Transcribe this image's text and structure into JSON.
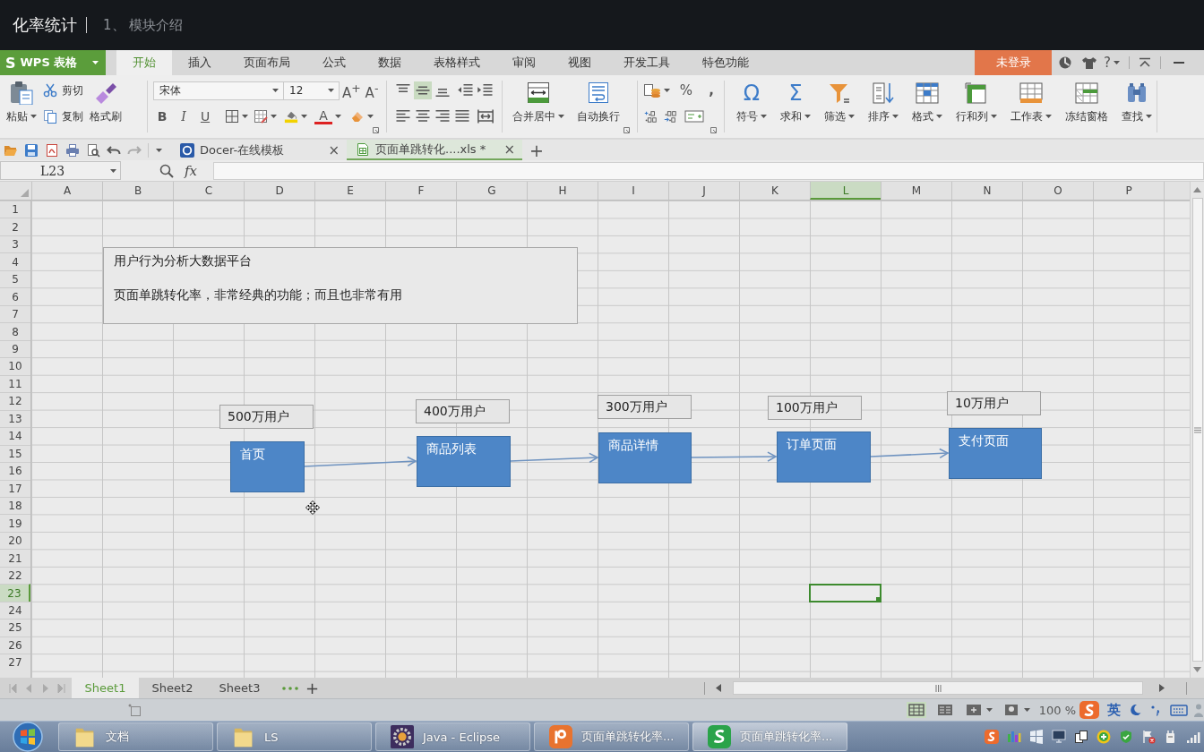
{
  "video_header": {
    "title": "化率统计",
    "subtitle": "1、 模块介绍"
  },
  "menu_bar": {
    "app_logo": "S",
    "app_name": "WPS 表格",
    "tabs": [
      {
        "label": "开始",
        "selected": true
      },
      {
        "label": "插入",
        "selected": false
      },
      {
        "label": "页面布局",
        "selected": false
      },
      {
        "label": "公式",
        "selected": false
      },
      {
        "label": "数据",
        "selected": false
      },
      {
        "label": "表格样式",
        "selected": false
      },
      {
        "label": "审阅",
        "selected": false
      },
      {
        "label": "视图",
        "selected": false
      },
      {
        "label": "开发工具",
        "selected": false
      },
      {
        "label": "特色功能",
        "selected": false
      }
    ],
    "login_button": "未登录",
    "help": "?"
  },
  "ribbon": {
    "paste": "粘贴",
    "cut": "剪切",
    "copy": "复制",
    "format_painter": "格式刷",
    "font_name": "宋体",
    "font_size": "12",
    "grow_font": "A$^{+}$",
    "shrink_font": "A$^{-}$",
    "bold": "B",
    "italic": "I",
    "underline": "U",
    "font_color": "A",
    "vertical_align": [
      {
        "selected": false
      },
      {
        "selected": true
      },
      {
        "selected": false
      }
    ],
    "merge_center": "合并居中",
    "wrap_text": "自动换行",
    "percent": "%",
    "thousands": ",",
    "tools": [
      {
        "label": "符号",
        "glyph": "Ω",
        "dropdown": true
      },
      {
        "label": "求和",
        "glyph": "Σ",
        "dropdown": true
      },
      {
        "label": "筛选",
        "dropdown": true
      },
      {
        "label": "排序",
        "dropdown": true
      },
      {
        "label": "格式",
        "dropdown": true
      },
      {
        "label": "行和列",
        "dropdown": true
      },
      {
        "label": "工作表",
        "dropdown": true
      },
      {
        "label": "冻结窗格",
        "dropdown": false
      },
      {
        "label": "查找",
        "dropdown": true
      }
    ]
  },
  "quick_bar": {
    "tabs": [
      {
        "label": "Docer-在线模板",
        "selected": false,
        "close": "×"
      },
      {
        "label": "页面单跳转化....xls *",
        "selected": true,
        "close": "×"
      }
    ],
    "new_tab": "+"
  },
  "formula_bar": {
    "cell_ref": "L23",
    "fx": "fx"
  },
  "sheet": {
    "columns": [
      {
        "label": "A",
        "selected": false
      },
      {
        "label": "B",
        "selected": false
      },
      {
        "label": "C",
        "selected": false
      },
      {
        "label": "D",
        "selected": false
      },
      {
        "label": "E",
        "selected": false
      },
      {
        "label": "F",
        "selected": false
      },
      {
        "label": "G",
        "selected": false
      },
      {
        "label": "H",
        "selected": false
      },
      {
        "label": "I",
        "selected": false
      },
      {
        "label": "J",
        "selected": false
      },
      {
        "label": "K",
        "selected": false
      },
      {
        "label": "L",
        "selected": true
      },
      {
        "label": "M",
        "selected": false
      },
      {
        "label": "N",
        "selected": false
      },
      {
        "label": "O",
        "selected": false
      },
      {
        "label": "P",
        "selected": false
      }
    ],
    "rows": [
      {
        "label": "1",
        "selected": false
      },
      {
        "label": "2",
        "selected": false
      },
      {
        "label": "3",
        "selected": false
      },
      {
        "label": "4",
        "selected": false
      },
      {
        "label": "5",
        "selected": false
      },
      {
        "label": "6",
        "selected": false
      },
      {
        "label": "7",
        "selected": false
      },
      {
        "label": "8",
        "selected": false
      },
      {
        "label": "9",
        "selected": false
      },
      {
        "label": "10",
        "selected": false
      },
      {
        "label": "11",
        "selected": false
      },
      {
        "label": "12",
        "selected": false
      },
      {
        "label": "13",
        "selected": false
      },
      {
        "label": "14",
        "selected": false
      },
      {
        "label": "15",
        "selected": false
      },
      {
        "label": "16",
        "selected": false
      },
      {
        "label": "17",
        "selected": false
      },
      {
        "label": "18",
        "selected": false
      },
      {
        "label": "19",
        "selected": false
      },
      {
        "label": "20",
        "selected": false
      },
      {
        "label": "21",
        "selected": false
      },
      {
        "label": "22",
        "selected": false
      },
      {
        "label": "23",
        "selected": true
      },
      {
        "label": "24",
        "selected": false
      },
      {
        "label": "25",
        "selected": false
      },
      {
        "label": "26",
        "selected": false
      },
      {
        "label": "27",
        "selected": false
      }
    ],
    "note": {
      "heading": "用户行为分析大数据平台",
      "text": "页面单跳转化率，非常经典的功能；而且也非常有用"
    },
    "funnel": [
      {
        "users": "500万用户",
        "page": "首页"
      },
      {
        "users": "400万用户",
        "page": "商品列表"
      },
      {
        "users": "300万用户",
        "page": "商品详情"
      },
      {
        "users": "100万用户",
        "page": "订单页面"
      },
      {
        "users": "10万用户",
        "page": "支付页面"
      }
    ]
  },
  "sheet_tabs": {
    "tabs": [
      {
        "label": "Sheet1",
        "selected": true
      },
      {
        "label": "Sheet2",
        "selected": false
      },
      {
        "label": "Sheet3",
        "selected": false
      }
    ],
    "add": "+"
  },
  "status_bar": {
    "views": [
      {
        "selected": true
      },
      {
        "selected": false
      },
      {
        "selected": false
      },
      {
        "selected": false
      }
    ],
    "zoom": "100 %",
    "input_mode": "英"
  },
  "taskbar": {
    "items": [
      {
        "label": "文档",
        "selected": false
      },
      {
        "label": "LS",
        "selected": false
      },
      {
        "label": "Java - Eclipse",
        "selected": false
      },
      {
        "label": "页面单跳转化率...",
        "selected": false
      },
      {
        "label": "页面单跳转化率...",
        "selected": true
      }
    ]
  }
}
